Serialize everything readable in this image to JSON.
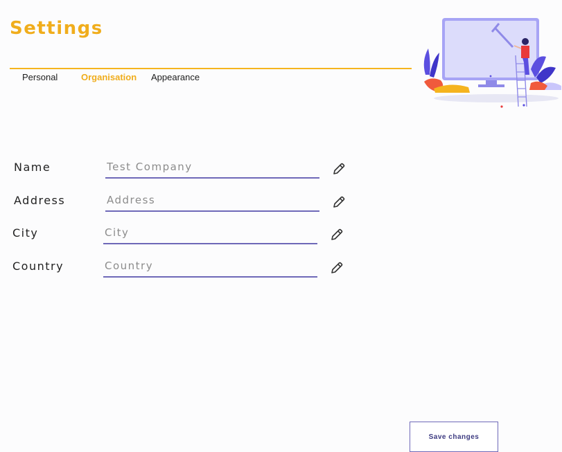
{
  "header": {
    "title": "Settings"
  },
  "tabs": [
    {
      "label": "Personal",
      "active": false
    },
    {
      "label": "Organisation",
      "active": true
    },
    {
      "label": "Appearance",
      "active": false
    }
  ],
  "form": {
    "fields": [
      {
        "label": "Name",
        "value": "",
        "placeholder": "Test Company"
      },
      {
        "label": "Address",
        "value": "",
        "placeholder": "Address"
      },
      {
        "label": "City",
        "value": "",
        "placeholder": "City"
      },
      {
        "label": "Country",
        "value": "",
        "placeholder": "Country"
      }
    ]
  },
  "actions": {
    "save_label": "Save changes"
  },
  "colors": {
    "accent": "#f0ad1c",
    "underline": "#6e68b8",
    "illustration_primary": "#a7a4f5",
    "illustration_secondary": "#5b4fe0"
  },
  "icons": {
    "edit": "pencil-icon",
    "illustration": "monitor-painter-illustration"
  }
}
